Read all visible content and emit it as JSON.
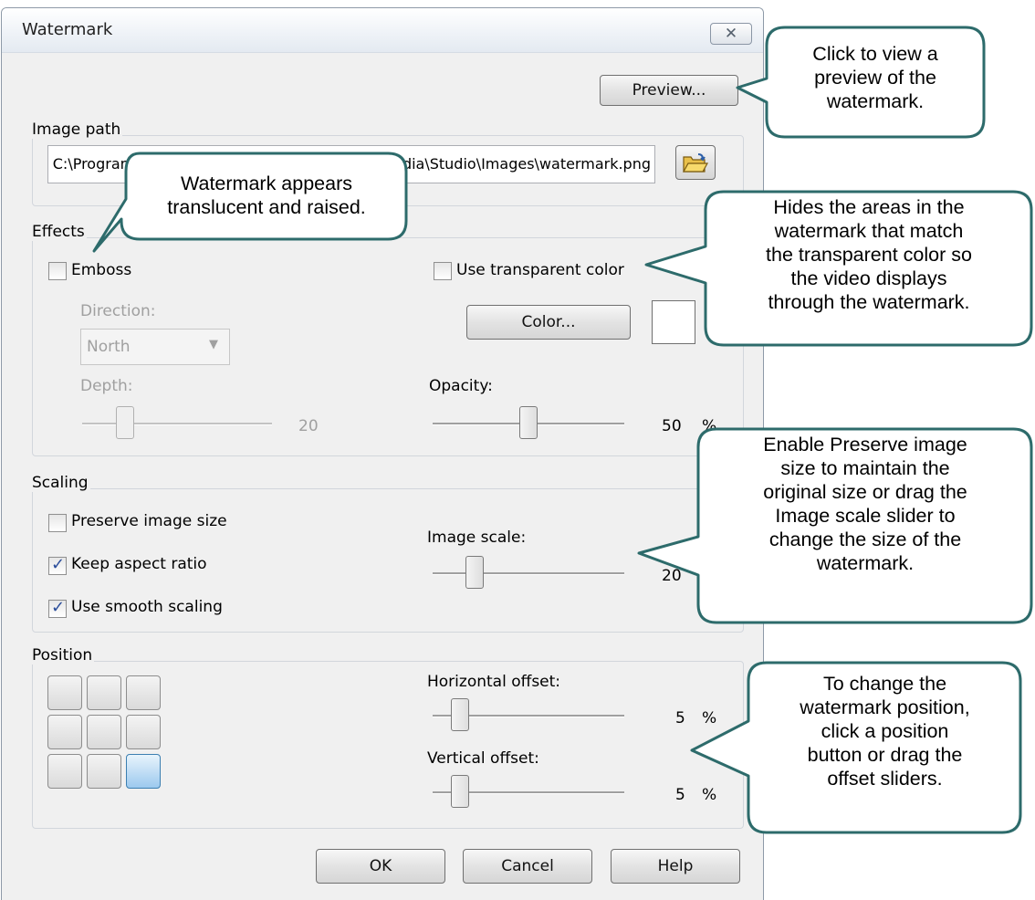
{
  "dialog": {
    "title": "Watermark",
    "close_glyph": "✕",
    "preview_label": "Preview...",
    "image_path": {
      "group_label": "Image path",
      "value": "C:\\Program Files\\TechSmith\\Camtasia Studio\\Media\\Studio\\Images\\watermark.png",
      "browse_icon": "open-folder-icon"
    },
    "effects": {
      "group_label": "Effects",
      "emboss_label": "Emboss",
      "emboss_checked": false,
      "direction_label": "Direction:",
      "direction_value": "North",
      "depth_label": "Depth:",
      "depth_value": "20",
      "use_transparent_label": "Use transparent color",
      "use_transparent_checked": false,
      "color_button_label": "Color...",
      "color_swatch": "#ffffff",
      "opacity_label": "Opacity:",
      "opacity_value": "50",
      "opacity_unit": "%"
    },
    "scaling": {
      "group_label": "Scaling",
      "preserve_label": "Preserve image size",
      "preserve_checked": false,
      "keep_aspect_label": "Keep aspect ratio",
      "keep_aspect_checked": true,
      "smooth_label": "Use smooth scaling",
      "smooth_checked": true,
      "image_scale_label": "Image scale:",
      "image_scale_value": "20"
    },
    "position": {
      "group_label": "Position",
      "selected_cell": "bottom-right",
      "horizontal_label": "Horizontal offset:",
      "horizontal_value": "5",
      "horizontal_unit": "%",
      "vertical_label": "Vertical offset:",
      "vertical_value": "5",
      "vertical_unit": "%"
    },
    "buttons": {
      "ok": "OK",
      "cancel": "Cancel",
      "help": "Help"
    }
  },
  "callouts": {
    "preview": [
      "Click to view a",
      "preview of the",
      "watermark."
    ],
    "emboss": [
      "Watermark appears",
      "translucent and raised."
    ],
    "transparent": [
      "Hides the areas in the",
      "watermark that match",
      "the transparent color so",
      "the video displays",
      "through the watermark."
    ],
    "scaling": [
      "Enable Preserve image",
      "size to maintain the",
      "original size or drag the",
      "Image scale slider to",
      "change the size of the",
      "watermark."
    ],
    "position": [
      "To change the",
      "watermark position,",
      "click a position",
      "button or drag the",
      "offset sliders."
    ]
  },
  "colors": {
    "callout_border": "#2d6b6b",
    "dialog_bg": "#f0f0f0",
    "checkmark": "#2a4d9b"
  }
}
